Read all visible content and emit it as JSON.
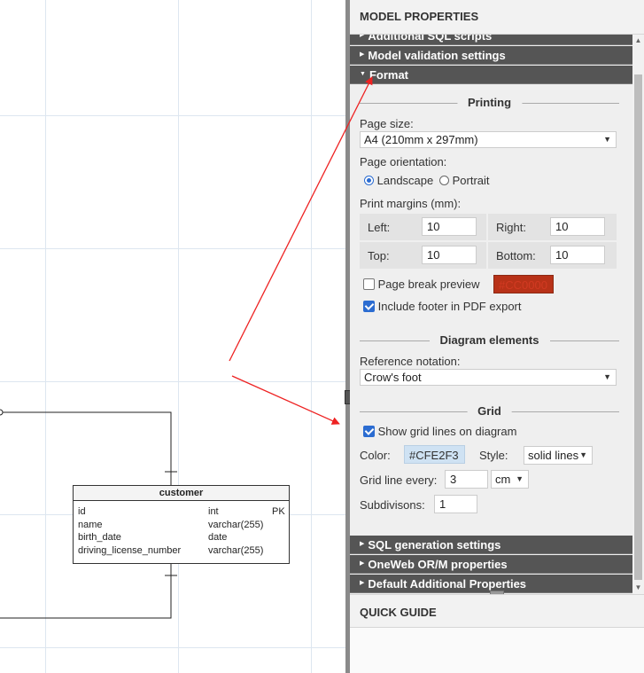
{
  "panel": {
    "title": "MODEL PROPERTIES",
    "sections_top": [
      {
        "label": "Additional SQL scripts"
      },
      {
        "label": "Model validation settings"
      },
      {
        "label": "Format"
      }
    ],
    "sections_bottom": [
      {
        "label": "SQL generation settings"
      },
      {
        "label": "OneWeb OR/M properties"
      },
      {
        "label": "Default Additional Properties"
      }
    ],
    "quick_guide_title": "QUICK GUIDE"
  },
  "format": {
    "printing_title": "Printing",
    "page_size_label": "Page size:",
    "page_size_value": "A4 (210mm x 297mm)",
    "orientation_label": "Page orientation:",
    "orientation_options": [
      "Landscape",
      "Portrait"
    ],
    "orientation_selected": "Landscape",
    "margins_label": "Print margins (mm):",
    "margin_left_label": "Left:",
    "margin_left": "10",
    "margin_right_label": "Right:",
    "margin_right": "10",
    "margin_top_label": "Top:",
    "margin_top": "10",
    "margin_bottom_label": "Bottom:",
    "margin_bottom": "10",
    "page_break_label": "Page break preview",
    "page_break_checked": false,
    "page_break_color": "#CC0000",
    "footer_label": "Include footer in PDF export",
    "footer_checked": true,
    "diagram_title": "Diagram elements",
    "ref_notation_label": "Reference notation:",
    "ref_notation_value": "Crow's foot",
    "grid_title": "Grid",
    "show_grid_label": "Show grid lines on diagram",
    "show_grid_checked": true,
    "color_label": "Color:",
    "grid_color": "#CFE2F3",
    "style_label": "Style:",
    "style_value": "solid lines",
    "grid_every_label": "Grid line every:",
    "grid_every_value": "3",
    "grid_unit": "cm",
    "subdivisions_label": "Subdivisons:",
    "subdivisions_value": "1"
  },
  "diagram": {
    "table_name": "customer",
    "columns": [
      {
        "name": "id",
        "type": "int",
        "key": "PK"
      },
      {
        "name": "name",
        "type": "varchar(255)",
        "key": ""
      },
      {
        "name": "birth_date",
        "type": "date",
        "key": ""
      },
      {
        "name": "driving_license_number",
        "type": "varchar(255)",
        "key": ""
      }
    ]
  },
  "colors": {
    "section_bg": "#555555",
    "annotation_arrow": "#ee2222",
    "accent": "#2b6cd1"
  }
}
